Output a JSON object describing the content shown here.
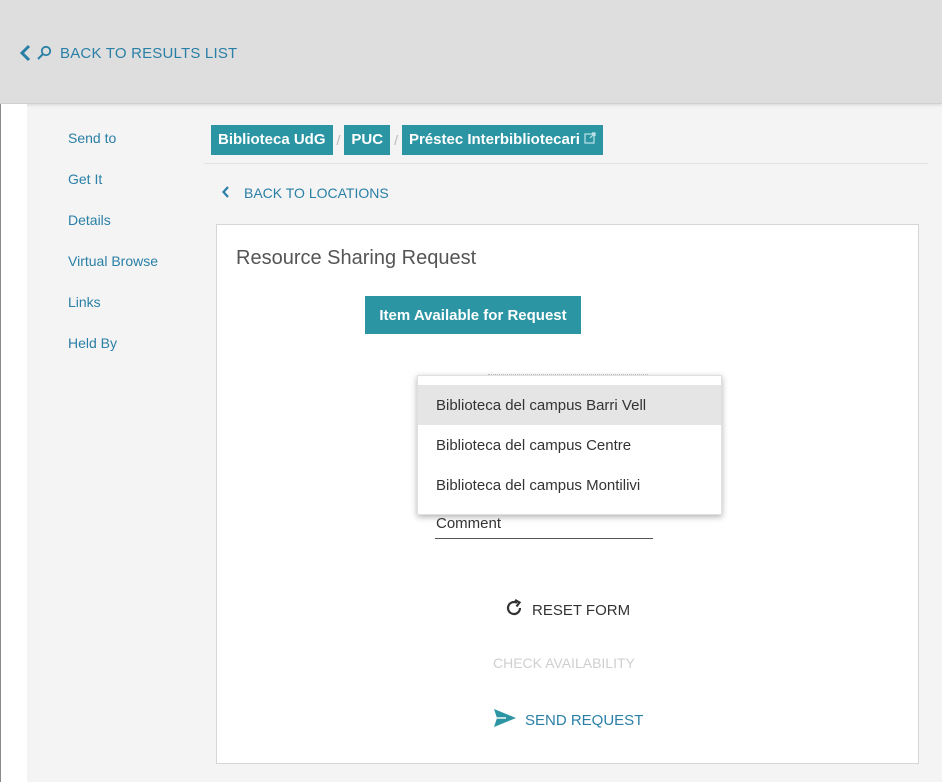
{
  "header": {
    "back_to_results": "BACK TO RESULTS LIST"
  },
  "sidenav": {
    "items": [
      {
        "label": "Send to"
      },
      {
        "label": "Get It"
      },
      {
        "label": "Details"
      },
      {
        "label": "Virtual Browse"
      },
      {
        "label": "Links"
      },
      {
        "label": "Held By"
      }
    ]
  },
  "breadcrumbs": {
    "items": [
      "Biblioteca UdG",
      "PUC",
      "Préstec Interbibliotecari"
    ],
    "separator": "/"
  },
  "back_to_locations": "BACK TO LOCATIONS",
  "card": {
    "title": "Resource Sharing Request",
    "availability_button": "Item Available for Request",
    "dropdown": {
      "options": [
        "Biblioteca del campus Barri Vell",
        "Biblioteca del campus Centre",
        "Biblioteca del campus Montilivi"
      ],
      "highlighted_index": 0
    },
    "comment_placeholder": "Comment",
    "reset_label": "RESET FORM",
    "check_label": "CHECK AVAILABILITY",
    "send_label": "SEND REQUEST"
  },
  "colors": {
    "accent": "#2b95a3",
    "link": "#2a7fa6",
    "disabled": "#cfcfcf"
  }
}
